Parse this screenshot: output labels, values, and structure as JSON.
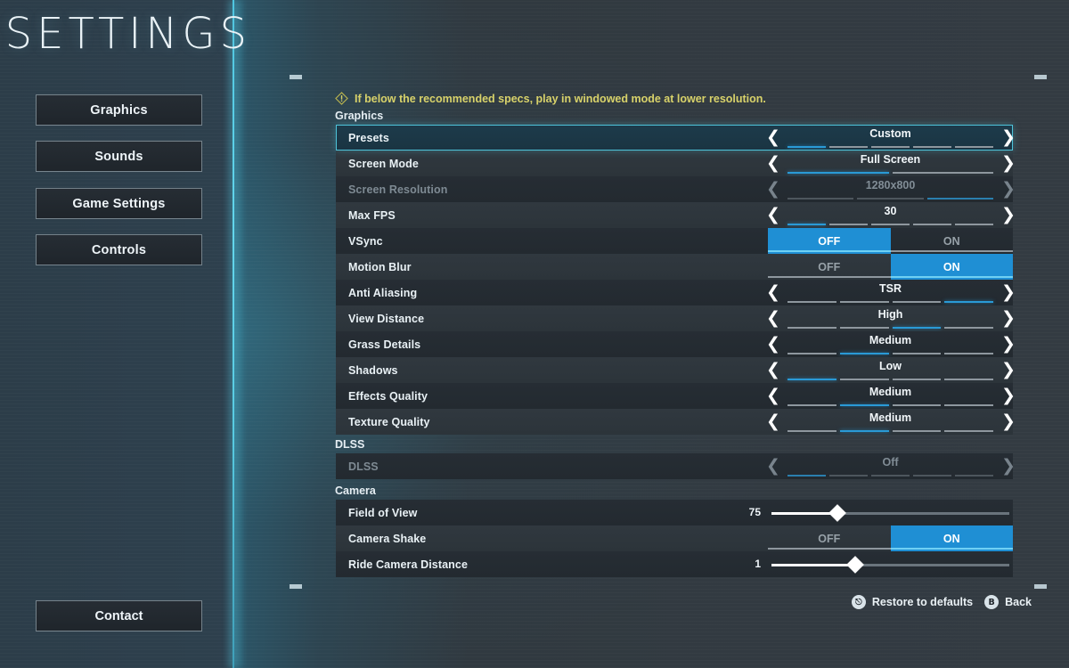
{
  "title": "SETTINGS",
  "sidebar": {
    "items": [
      {
        "label": "Graphics"
      },
      {
        "label": "Sounds"
      },
      {
        "label": "Game Settings"
      },
      {
        "label": "Controls"
      }
    ],
    "contact_label": "Contact"
  },
  "warning": {
    "icon": "warning-diamond-icon",
    "text": "If below the recommended specs, play in windowed mode at lower resolution."
  },
  "sections": {
    "graphics_header": "Graphics",
    "dlss_header": "DLSS",
    "camera_header": "Camera"
  },
  "colors": {
    "accent_cyan": "#4ec3d9",
    "toggle_blue": "#1f8fd4",
    "segment_on": "#2a9ad6",
    "warning_yellow": "#d8d26a",
    "row_dark": "#262d34",
    "row_light": "#30383f",
    "selected_row_bg": "#1d3b4b"
  },
  "graphics_rows": [
    {
      "label": "Presets",
      "type": "stepper",
      "value": "Custom",
      "segments": 5,
      "active": 1,
      "selected": true,
      "disabled": false
    },
    {
      "label": "Screen Mode",
      "type": "stepper",
      "value": "Full Screen",
      "segments": 2,
      "active": 1,
      "selected": false,
      "disabled": false
    },
    {
      "label": "Screen Resolution",
      "type": "stepper",
      "value": "1280x800",
      "segments": 3,
      "active": 3,
      "selected": false,
      "disabled": true
    },
    {
      "label": "Max FPS",
      "type": "stepper",
      "value": "30",
      "segments": 5,
      "active": 1,
      "selected": false,
      "disabled": false
    },
    {
      "label": "VSync",
      "type": "toggle",
      "off_label": "OFF",
      "on_label": "ON",
      "value": "OFF",
      "selected": false,
      "disabled": false
    },
    {
      "label": "Motion Blur",
      "type": "toggle",
      "off_label": "OFF",
      "on_label": "ON",
      "value": "ON",
      "selected": false,
      "disabled": false
    },
    {
      "label": "Anti Aliasing",
      "type": "stepper",
      "value": "TSR",
      "segments": 4,
      "active": 4,
      "selected": false,
      "disabled": false
    },
    {
      "label": "View Distance",
      "type": "stepper",
      "value": "High",
      "segments": 4,
      "active": 3,
      "selected": false,
      "disabled": false
    },
    {
      "label": "Grass Details",
      "type": "stepper",
      "value": "Medium",
      "segments": 4,
      "active": 2,
      "selected": false,
      "disabled": false
    },
    {
      "label": "Shadows",
      "type": "stepper",
      "value": "Low",
      "segments": 4,
      "active": 1,
      "selected": false,
      "disabled": false
    },
    {
      "label": "Effects Quality",
      "type": "stepper",
      "value": "Medium",
      "segments": 4,
      "active": 2,
      "selected": false,
      "disabled": false
    },
    {
      "label": "Texture Quality",
      "type": "stepper",
      "value": "Medium",
      "segments": 4,
      "active": 2,
      "selected": false,
      "disabled": false
    }
  ],
  "dlss_rows": [
    {
      "label": "DLSS",
      "type": "stepper",
      "value": "Off",
      "segments": 5,
      "active": 1,
      "selected": false,
      "disabled": true
    }
  ],
  "camera_rows": [
    {
      "label": "Field of View",
      "type": "slider",
      "value": "75",
      "percent": 27,
      "selected": false,
      "disabled": false
    },
    {
      "label": "Camera Shake",
      "type": "toggle",
      "off_label": "OFF",
      "on_label": "ON",
      "value": "ON",
      "selected": false,
      "disabled": false
    },
    {
      "label": "Ride Camera Distance",
      "type": "slider",
      "value": "1",
      "percent": 34,
      "selected": false,
      "disabled": false
    }
  ],
  "footer": {
    "restore_label": "Restore to defaults",
    "restore_button_glyph": "⎋",
    "back_label": "Back",
    "back_button_glyph": "B"
  },
  "arrows": {
    "left": "❮",
    "right": "❯"
  }
}
